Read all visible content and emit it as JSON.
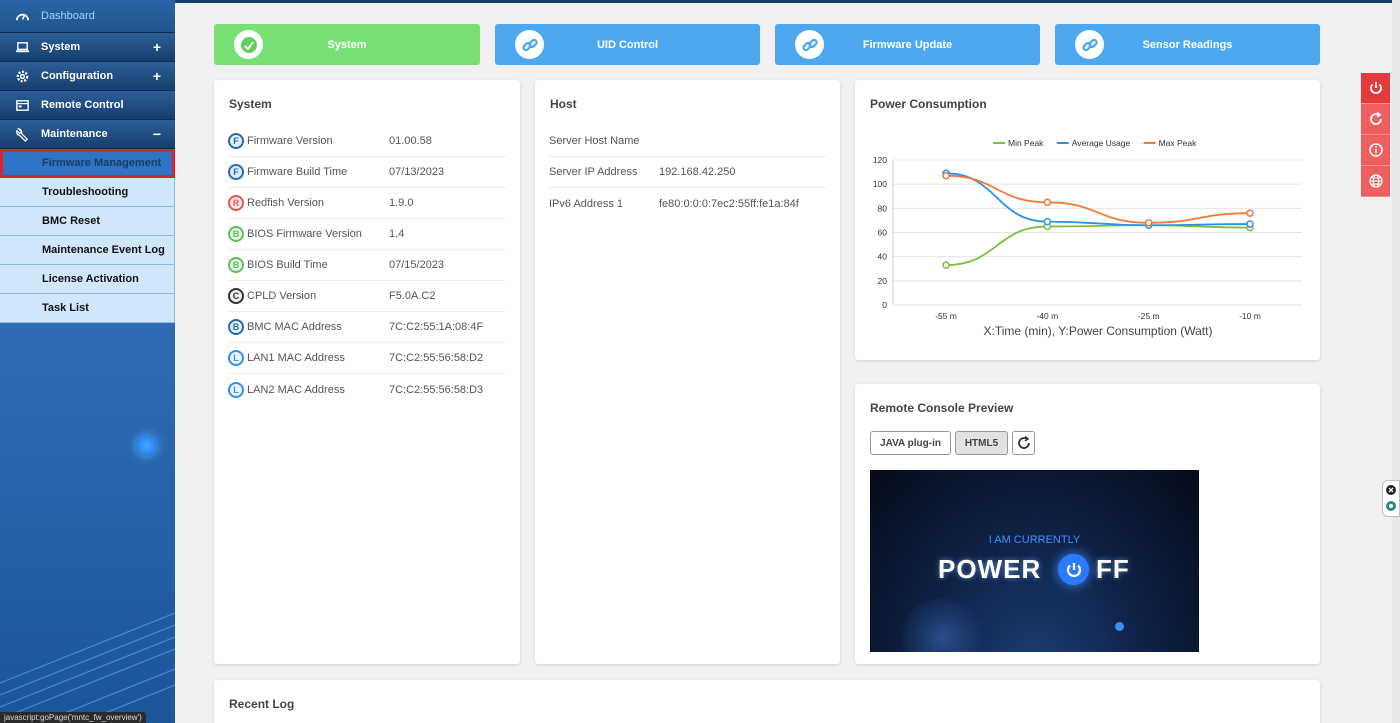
{
  "sidebar": {
    "dashboard": "Dashboard",
    "items": [
      {
        "label": "System",
        "toggle": "+"
      },
      {
        "label": "Configuration",
        "toggle": "+"
      },
      {
        "label": "Remote Control",
        "toggle": ""
      },
      {
        "label": "Maintenance",
        "toggle": "−"
      }
    ],
    "sub_items": [
      {
        "label": "Firmware Management",
        "active": true
      },
      {
        "label": "Troubleshooting"
      },
      {
        "label": "BMC Reset"
      },
      {
        "label": "Maintenance Event Log"
      },
      {
        "label": "License Activation"
      },
      {
        "label": "Task List"
      }
    ],
    "status_tip": "javascript:goPage('mntc_fw_overview')"
  },
  "topcards": [
    {
      "label": "System",
      "color": "#79e075"
    },
    {
      "label": "UID Control",
      "color": "#4ea8ef"
    },
    {
      "label": "Firmware Update",
      "color": "#4ea8ef"
    },
    {
      "label": "Sensor Readings",
      "color": "#4ea8ef"
    }
  ],
  "system_panel": {
    "title": "System",
    "rows": [
      {
        "badge": "F",
        "label": "Firmware Version",
        "value": "01.00.58"
      },
      {
        "badge": "F",
        "label": "Firmware Build Time",
        "value": "07/13/2023"
      },
      {
        "badge": "R",
        "label": "Redfish Version",
        "value": "1.9.0"
      },
      {
        "badge": "B",
        "label": "BIOS Firmware Version",
        "value": "1.4"
      },
      {
        "badge": "B",
        "label": "BIOS Build Time",
        "value": "07/15/2023"
      },
      {
        "badge": "C",
        "label": "CPLD Version",
        "value": "F5.0A.C2"
      },
      {
        "badge": "B",
        "label": "BMC MAC Address",
        "value": "7C:C2:55:1A:08:4F"
      },
      {
        "badge": "L",
        "label": "LAN1 MAC Address",
        "value": "7C:C2:55:56:58:D2"
      },
      {
        "badge": "L",
        "label": "LAN2 MAC Address",
        "value": "7C:C2:55:56:58:D3"
      }
    ]
  },
  "host_panel": {
    "title": "Host",
    "rows": [
      {
        "label": "Server Host Name",
        "value": ""
      },
      {
        "label": "Server IP Address",
        "value": "192.168.42.250"
      },
      {
        "label": "IPv6 Address 1",
        "value": "fe80:0:0:0:7ec2:55ff:fe1a:84f"
      }
    ]
  },
  "power_panel": {
    "title": "Power Consumption"
  },
  "chart_data": {
    "type": "line",
    "categories": [
      "-55 m",
      "-40 m",
      "-25 m",
      "-10 m"
    ],
    "series": [
      {
        "name": "Min Peak",
        "color": "#7cc13a",
        "values": [
          33,
          65,
          66,
          64
        ]
      },
      {
        "name": "Average Usage",
        "color": "#2f8ff0",
        "values": [
          109,
          69,
          66,
          67
        ]
      },
      {
        "name": "Max Peak",
        "color": "#f07a3a",
        "values": [
          107,
          85,
          68,
          76
        ]
      }
    ],
    "xlabel": "X:Time (min), Y:Power Consumption (Watt)",
    "ylim": [
      0,
      120
    ],
    "yticks": [
      0,
      20,
      40,
      60,
      80,
      100,
      120
    ],
    "legend": "top-center",
    "grid": true
  },
  "console_panel": {
    "title": "Remote Console Preview",
    "java_label": "JAVA plug-in",
    "html5_label": "HTML5",
    "line1": "I AM CURRENTLY",
    "line2": "POWER",
    "line3": "FF"
  },
  "recent_log": {
    "title": "Recent Log"
  }
}
